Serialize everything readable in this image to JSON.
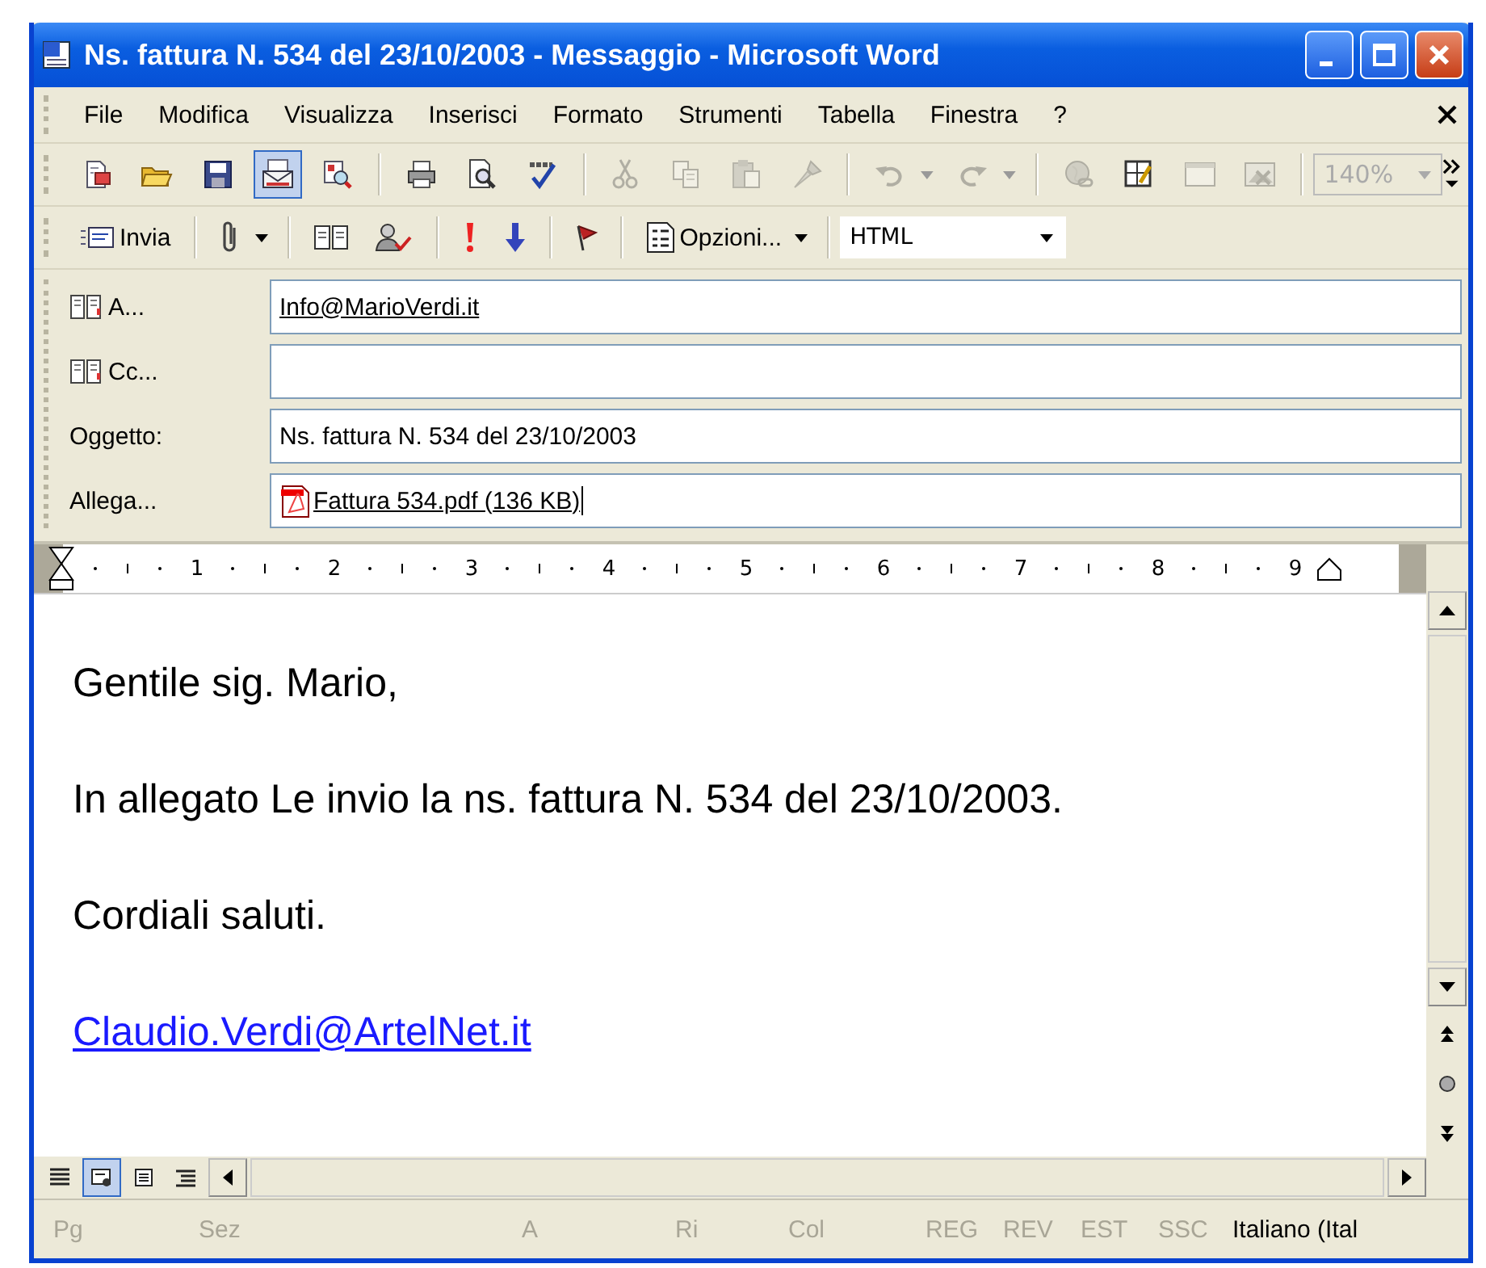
{
  "window": {
    "title": "Ns. fattura N. 534 del 23/10/2003 - Messaggio - Microsoft Word"
  },
  "menu": {
    "items": [
      "File",
      "Modifica",
      "Visualizza",
      "Inserisci",
      "Formato",
      "Strumenti",
      "Tabella",
      "Finestra",
      "?"
    ]
  },
  "standard_toolbar": {
    "buttons": [
      {
        "selected": false,
        "disabled": false
      },
      {
        "selected": false,
        "disabled": false
      },
      {
        "selected": false,
        "disabled": false
      },
      {
        "selected": true,
        "disabled": false
      },
      {
        "selected": false,
        "disabled": false
      },
      {
        "selected": false,
        "disabled": false
      },
      {
        "selected": false,
        "disabled": false
      },
      {
        "selected": false,
        "disabled": false
      },
      {
        "selected": false,
        "disabled": true
      },
      {
        "selected": false,
        "disabled": true
      },
      {
        "selected": false,
        "disabled": true
      },
      {
        "selected": false,
        "disabled": true
      },
      {
        "selected": false,
        "disabled": true
      },
      {
        "selected": false,
        "disabled": true
      },
      {
        "selected": false,
        "disabled": true
      },
      {
        "selected": false,
        "disabled": false
      },
      {
        "selected": false,
        "disabled": true
      },
      {
        "selected": false,
        "disabled": true
      }
    ],
    "zoom": {
      "value": "140%",
      "disabled": true
    }
  },
  "email_toolbar": {
    "send": "Invia",
    "options": "Opzioni...",
    "format": "HTML"
  },
  "header_fields": [
    {
      "kind": "address",
      "label": "A...",
      "value": "Info@MarioVerdi.it"
    },
    {
      "kind": "address",
      "label": "Cc..."
    },
    {
      "kind": "text",
      "label": "Oggetto:",
      "value": "Ns. fattura N. 534 del 23/10/2003"
    },
    {
      "kind": "attachment",
      "label": "Allega...",
      "value": "Fattura 534.pdf (136 KB)"
    }
  ],
  "ruler": {
    "numbers": [
      "1",
      "2",
      "3",
      "4",
      "5",
      "6",
      "7",
      "8",
      "9"
    ]
  },
  "body": {
    "paragraphs": [
      {
        "kind": "text",
        "text": "Gentile sig. Mario,"
      },
      {
        "kind": "text",
        "text": "In allegato Le invio la ns. fattura N. 534 del 23/10/2003."
      },
      {
        "kind": "text",
        "text": "Cordiali saluti."
      },
      {
        "kind": "link",
        "text": "Claudio.Verdi@ArtelNet.it"
      }
    ]
  },
  "view_buttons": [
    {
      "selected": false
    },
    {
      "selected": true
    },
    {
      "selected": false
    },
    {
      "selected": false
    }
  ],
  "status_bar": {
    "fields": [
      {
        "text": "Pg",
        "disabled": true
      },
      {
        "text": "Sez",
        "disabled": true
      },
      {
        "text": "A",
        "disabled": true
      },
      {
        "text": "Ri",
        "disabled": true
      },
      {
        "text": "Col",
        "disabled": true
      },
      {
        "text": "REG",
        "disabled": true
      },
      {
        "text": "REV",
        "disabled": true
      },
      {
        "text": "EST",
        "disabled": true
      },
      {
        "text": "SSC",
        "disabled": true
      },
      {
        "text": "Italiano (Ital",
        "disabled": false
      }
    ]
  }
}
